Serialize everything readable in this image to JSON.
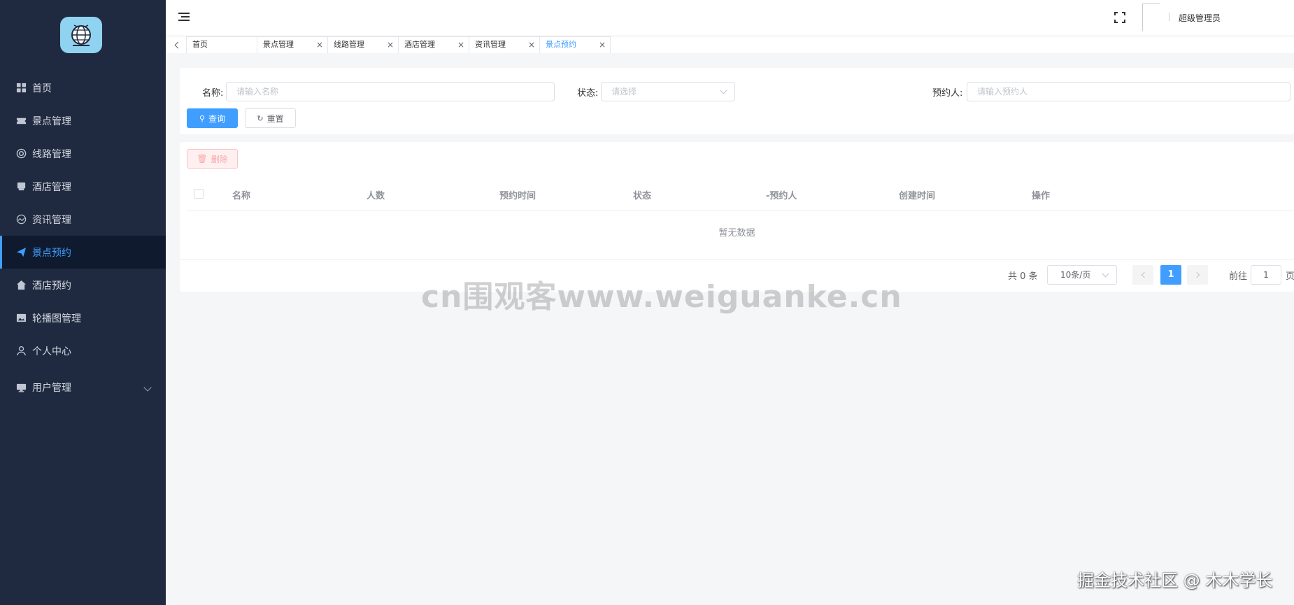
{
  "header": {
    "username": "超级管理员"
  },
  "sidebar": {
    "items": [
      {
        "label": "首页",
        "icon": "grid-icon"
      },
      {
        "label": "景点管理",
        "icon": "ticket-icon"
      },
      {
        "label": "线路管理",
        "icon": "lifebuoy-icon"
      },
      {
        "label": "酒店管理",
        "icon": "bed-icon"
      },
      {
        "label": "资讯管理",
        "icon": "chart-icon"
      },
      {
        "label": "景点预约",
        "icon": "send-icon",
        "active": true
      },
      {
        "label": "酒店预约",
        "icon": "home-icon"
      },
      {
        "label": "轮播图管理",
        "icon": "picture-icon"
      },
      {
        "label": "个人中心",
        "icon": "user-icon"
      },
      {
        "label": "用户管理",
        "icon": "monitor-icon",
        "expandable": true
      }
    ]
  },
  "tabs": [
    {
      "label": "首页"
    },
    {
      "label": "景点管理",
      "close": "×"
    },
    {
      "label": "线路管理",
      "close": "×"
    },
    {
      "label": "酒店管理",
      "close": "×"
    },
    {
      "label": "资讯管理",
      "close": "×"
    },
    {
      "label": "景点预约",
      "close": "×",
      "active": true
    }
  ],
  "search": {
    "name_label": "名称:",
    "name_placeholder": "请输入名称",
    "status_label": "状态:",
    "status_placeholder": "请选择",
    "booker_label": "预约人:",
    "booker_placeholder": "请输入预约人",
    "query_button": "查询",
    "reset_button": "重置"
  },
  "table": {
    "delete_button": "删除",
    "columns": [
      "名称",
      "人数",
      "预约时间",
      "状态",
      "-预约人",
      "创建时间",
      "操作"
    ],
    "empty_text": "暂无数据"
  },
  "pagination": {
    "total": "共 0 条",
    "page_size": "10条/页",
    "current_page": "1",
    "goto_label": "前往",
    "goto_value": "1",
    "page_suffix": "页"
  },
  "watermark": {
    "center": "cn围观客www.weiguanke.cn",
    "corner": "掘金技术社区 @ 木木学长"
  },
  "colors": {
    "sidebar_bg": "#1f2a40",
    "accent": "#409eff"
  }
}
